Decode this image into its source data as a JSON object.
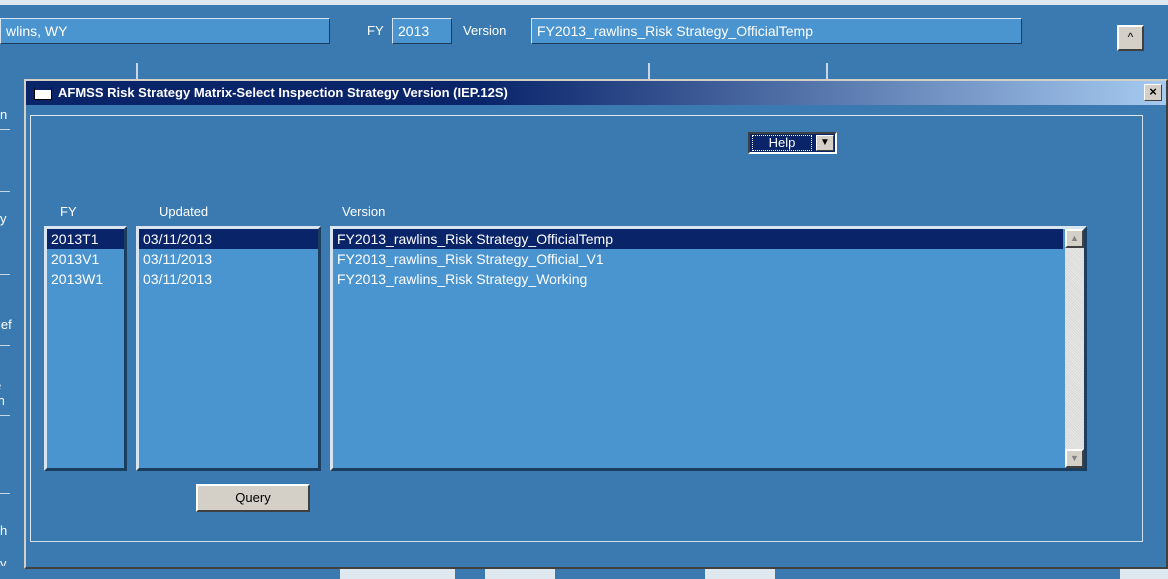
{
  "background": {
    "location_field": "wlins, WY",
    "fy_label": "FY",
    "fy_value": "2013",
    "version_label": "Version",
    "version_value": "FY2013_rawlins_Risk Strategy_OfficialTemp",
    "scroll_button_glyph": "^",
    "cut_labels": [
      "n",
      "y",
      "ief",
      "e In",
      "h",
      "y"
    ]
  },
  "dialog": {
    "title": "AFMSS Risk Strategy Matrix-Select Inspection Strategy Version (IEP.12S)",
    "close_glyph": "×",
    "help_dropdown": {
      "selected": "Help",
      "arrow": "▼"
    },
    "columns": {
      "fy": "FY",
      "updated": "Updated",
      "version": "Version"
    },
    "rows": [
      {
        "fy": "2013T1",
        "updated": "03/11/2013",
        "version": "FY2013_rawlins_Risk Strategy_OfficialTemp",
        "selected": true
      },
      {
        "fy": "2013V1",
        "updated": "03/11/2013",
        "version": "FY2013_rawlins_Risk Strategy_Official_V1",
        "selected": false
      },
      {
        "fy": "2013W1",
        "updated": "03/11/2013",
        "version": "FY2013_rawlins_Risk Strategy_Working",
        "selected": false
      }
    ],
    "query_button": "Query"
  },
  "colors": {
    "background": "#3a7ab0",
    "listbox": "#4a94d0",
    "selection": "#0a246a",
    "button_face": "#d4d0c8"
  }
}
